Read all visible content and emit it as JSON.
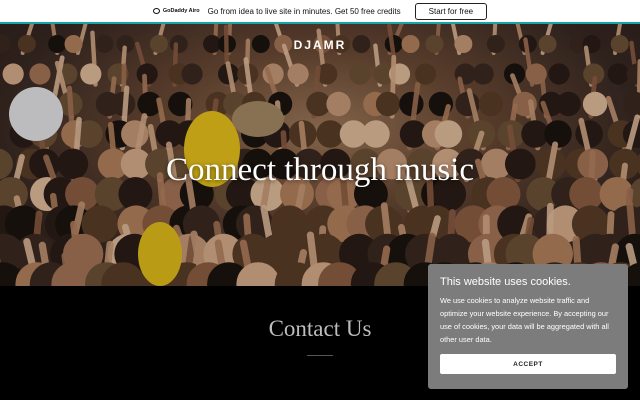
{
  "promo": {
    "logo_text": "GoDaddy Airo",
    "message": "Go from idea to live site in minutes. Get 50 free credits",
    "cta_label": "Start for free"
  },
  "hero": {
    "brand": "DJAMR",
    "headline": "Connect through music"
  },
  "contact": {
    "title": "Contact Us"
  },
  "cookie": {
    "title": "This website uses cookies.",
    "body": "We use cookies to analyze website traffic and optimize your website experience. By accepting our use of cookies, your data will be aggregated with all other user data.",
    "accept_label": "ACCEPT"
  },
  "colors": {
    "promo_accent": "#17a4a4",
    "cookie_bg": "#7c7c7c",
    "page_bg": "#000000"
  }
}
